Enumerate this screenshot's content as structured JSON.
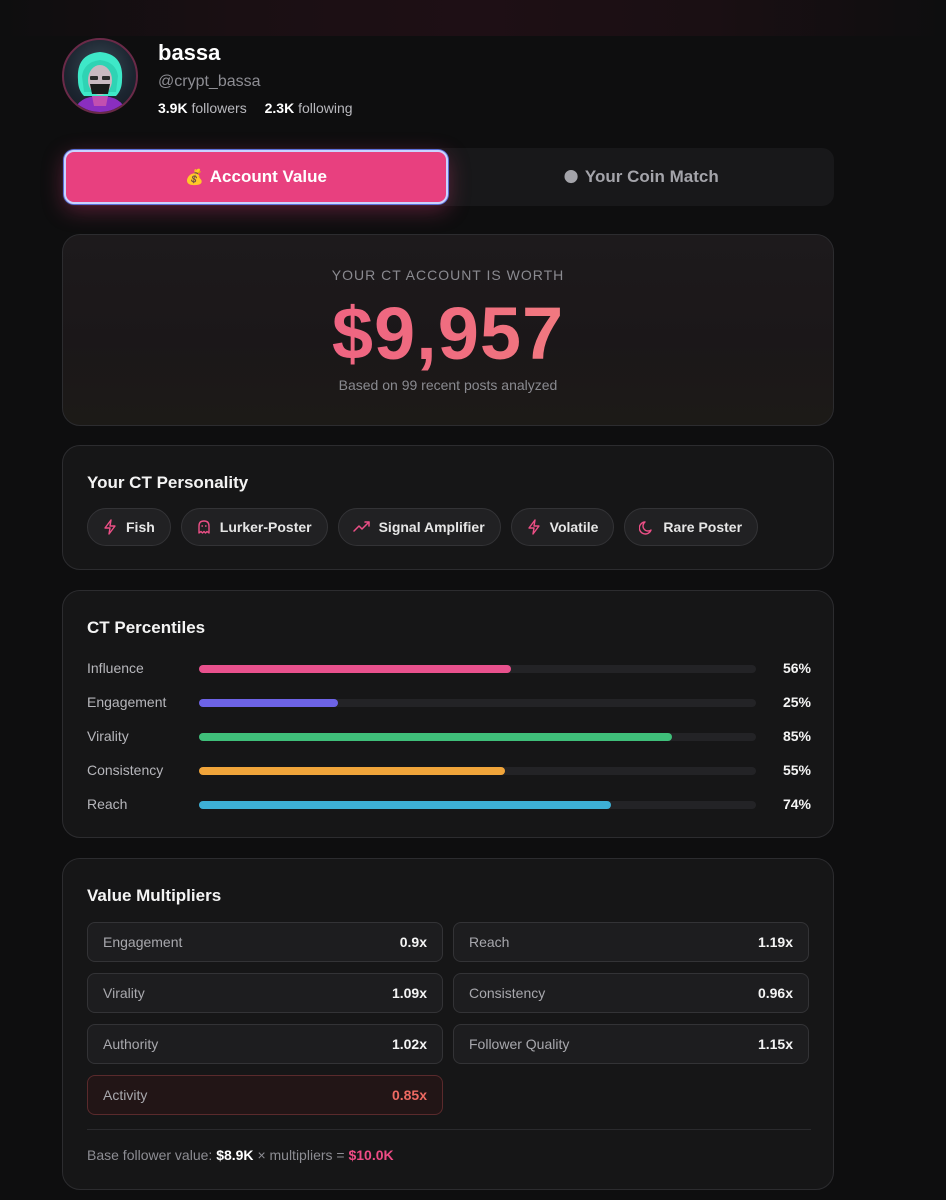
{
  "profile": {
    "name": "bassa",
    "handle": "@crypt_bassa",
    "followers_count": "3.9K",
    "followers_label": "followers",
    "following_count": "2.3K",
    "following_label": "following"
  },
  "tabs": [
    {
      "icon": "money-bag-icon",
      "glyph": "💰",
      "label": "Account Value",
      "active": true
    },
    {
      "icon": "moon-icon",
      "glyph": "🌑",
      "label": "Your Coin Match",
      "active": false
    }
  ],
  "worth": {
    "label": "YOUR CT ACCOUNT IS WORTH",
    "value": "$9,957",
    "subtitle": "Based on 99 recent posts analyzed"
  },
  "personality": {
    "title": "Your CT Personality",
    "traits": [
      {
        "label": "Fish",
        "icon": "lightning-icon"
      },
      {
        "label": "Lurker-Poster",
        "icon": "ghost-icon"
      },
      {
        "label": "Signal Amplifier",
        "icon": "trending-up-icon"
      },
      {
        "label": "Volatile",
        "icon": "lightning-icon"
      },
      {
        "label": "Rare Poster",
        "icon": "moon-icon"
      }
    ]
  },
  "percentiles": {
    "title": "CT Percentiles",
    "rows": [
      {
        "label": "Influence",
        "value": 56,
        "display": "56%",
        "color": "#e8518d"
      },
      {
        "label": "Engagement",
        "value": 25,
        "display": "25%",
        "color": "#6d63e6"
      },
      {
        "label": "Virality",
        "value": 85,
        "display": "85%",
        "color": "#3fbf7a"
      },
      {
        "label": "Consistency",
        "value": 55,
        "display": "55%",
        "color": "#f0a43a"
      },
      {
        "label": "Reach",
        "value": 74,
        "display": "74%",
        "color": "#3db0d6"
      }
    ]
  },
  "multipliers": {
    "title": "Value Multipliers",
    "items": [
      {
        "label": "Engagement",
        "value": "0.9x",
        "warn": false
      },
      {
        "label": "Reach",
        "value": "1.19x",
        "warn": false
      },
      {
        "label": "Virality",
        "value": "1.09x",
        "warn": false
      },
      {
        "label": "Consistency",
        "value": "0.96x",
        "warn": false
      },
      {
        "label": "Authority",
        "value": "1.02x",
        "warn": false
      },
      {
        "label": "Follower Quality",
        "value": "1.15x",
        "warn": false
      },
      {
        "label": "Activity",
        "value": "0.85x",
        "warn": true
      }
    ],
    "footer": {
      "prefix": "Base follower value:",
      "base": "$8.9K",
      "middle": "× multipliers =",
      "total": "$10.0K"
    }
  },
  "colors": {
    "accent": "#e8407f",
    "background": "#0e0e0f",
    "card": "#161617",
    "warn": "#ee6a62"
  }
}
